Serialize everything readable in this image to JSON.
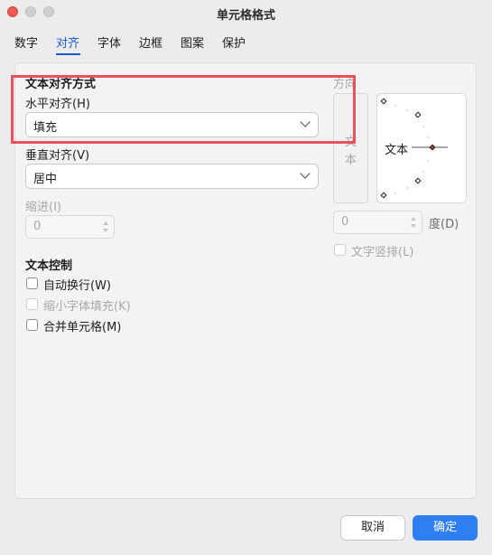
{
  "window": {
    "title": "单元格格式"
  },
  "tabs": [
    "数字",
    "对齐",
    "字体",
    "边框",
    "图案",
    "保护"
  ],
  "active_tab": "对齐",
  "alignment": {
    "section_label": "文本对齐方式",
    "horizontal_label": "水平对齐(H)",
    "horizontal_value": "填充",
    "vertical_label": "垂直对齐(V)",
    "vertical_value": "居中",
    "indent_label": "缩进(I)",
    "indent_value": "0"
  },
  "text_control": {
    "section_label": "文本控制",
    "wrap_label": "自动换行(W)",
    "shrink_label": "缩小字体填充(K)",
    "merge_label": "合并单元格(M)"
  },
  "orientation": {
    "label": "方向",
    "vertical_text": "文本",
    "dial_text": "文本",
    "degree_value": "0",
    "degree_label": "度(D)",
    "vertical_stack_label": "文字竖排(L)"
  },
  "buttons": {
    "cancel": "取消",
    "ok": "确定"
  },
  "colors": {
    "accent": "#2f7ef3",
    "highlight": "#e8525a"
  }
}
